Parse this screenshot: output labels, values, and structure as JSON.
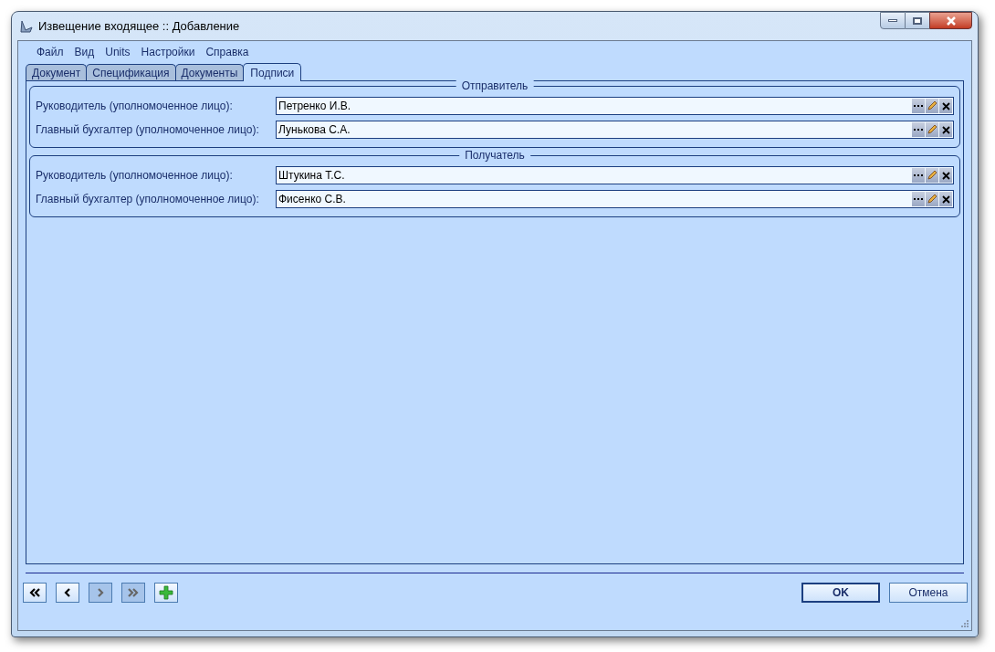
{
  "window": {
    "title": "Извещение входящее :: Добавление"
  },
  "menu": [
    "Файл",
    "Вид",
    "Units",
    "Настройки",
    "Справка"
  ],
  "tabs": [
    {
      "label": "Документ",
      "selected": false
    },
    {
      "label": "Спецификация",
      "selected": false
    },
    {
      "label": "Документы",
      "selected": false
    },
    {
      "label": "Подписи",
      "selected": true
    }
  ],
  "groups": [
    {
      "title": "Отправитель",
      "fields": [
        {
          "label": "Руководитель (уполномоченное лицо):",
          "value": "Петренко И.В."
        },
        {
          "label": "Главный бухгалтер (уполномоченное лицо):",
          "value": "Лунькова С.А."
        }
      ]
    },
    {
      "title": "Получатель",
      "fields": [
        {
          "label": "Руководитель (уполномоченное лицо):",
          "value": "Штукина Т.С."
        },
        {
          "label": "Главный бухгалтер (уполномоченное лицо):",
          "value": "Фисенко С.В."
        }
      ]
    }
  ],
  "nav_buttons": [
    {
      "kind": "first",
      "disabled": false
    },
    {
      "kind": "prev",
      "disabled": false
    },
    {
      "kind": "next",
      "disabled": true
    },
    {
      "kind": "last",
      "disabled": true
    },
    {
      "kind": "add",
      "disabled": false
    }
  ],
  "buttons": [
    {
      "label": "OK",
      "default": true
    },
    {
      "label": "Отмена",
      "default": false
    }
  ]
}
